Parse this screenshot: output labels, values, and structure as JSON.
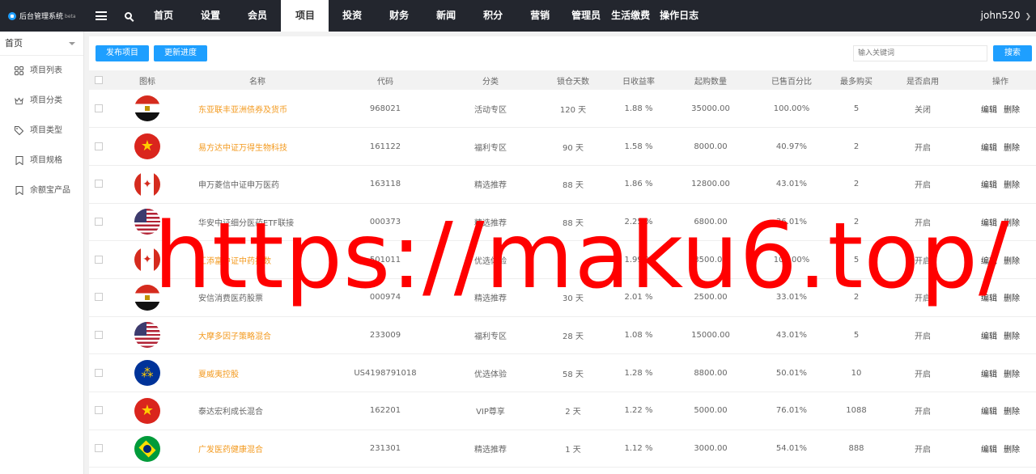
{
  "app": {
    "title": "后台管理系统",
    "badge": "beta"
  },
  "nav": {
    "items": [
      {
        "label": "首页"
      },
      {
        "label": "设置"
      },
      {
        "label": "会员"
      },
      {
        "label": "项目",
        "active": true
      },
      {
        "label": "投资"
      },
      {
        "label": "财务"
      },
      {
        "label": "新闻"
      },
      {
        "label": "积分"
      },
      {
        "label": "营销"
      },
      {
        "label": "管理员"
      },
      {
        "label": "生活缴费"
      },
      {
        "label": "操作日志"
      }
    ],
    "user": "john520"
  },
  "sidebar": {
    "title": "首页",
    "items": [
      {
        "label": "项目列表",
        "icon": "grid-icon"
      },
      {
        "label": "项目分类",
        "icon": "crown-icon"
      },
      {
        "label": "项目类型",
        "icon": "tag-icon"
      },
      {
        "label": "项目规格",
        "icon": "bookmark-icon"
      },
      {
        "label": "余额宝产品",
        "icon": "bookmark-icon"
      }
    ]
  },
  "toolbar": {
    "publish_label": "发布项目",
    "update_label": "更新进度",
    "search_placeholder": "输入关键词",
    "search_label": "搜索"
  },
  "table": {
    "headers": [
      "",
      "图标",
      "名称",
      "代码",
      "分类",
      "锁仓天数",
      "日收益率",
      "起购数量",
      "已售百分比",
      "最多购买",
      "是否启用",
      "操作"
    ],
    "rows": [
      {
        "flag": "egypt",
        "name": "东亚联丰亚洲债券及货币",
        "hl": true,
        "code": "968021",
        "category": "活动专区",
        "days": "120 天",
        "rate": "1.88 %",
        "min": "35000.00",
        "sold": "100.00%",
        "max": "5",
        "enabled": "关闭"
      },
      {
        "flag": "vietnam",
        "name": "易方达中证万得生物科技",
        "hl": true,
        "code": "161122",
        "category": "福利专区",
        "days": "90 天",
        "rate": "1.58 %",
        "min": "8000.00",
        "sold": "40.97%",
        "max": "2",
        "enabled": "开启"
      },
      {
        "flag": "canada",
        "name": "申万菱信中证申万医药",
        "hl": false,
        "code": "163118",
        "category": "精选推荐",
        "days": "88 天",
        "rate": "1.86 %",
        "min": "12800.00",
        "sold": "43.01%",
        "max": "2",
        "enabled": "开启"
      },
      {
        "flag": "usa",
        "name": "华安中证细分医药ETF联接",
        "hl": false,
        "code": "000373",
        "category": "精选推荐",
        "days": "88 天",
        "rate": "2.25 %",
        "min": "6800.00",
        "sold": "36.01%",
        "max": "2",
        "enabled": "开启"
      },
      {
        "flag": "canada",
        "name": "汇添富中证中药指数",
        "hl": true,
        "code": "501011",
        "category": "优选体验",
        "days": "",
        "rate": "1.99 %",
        "min": "3500.00",
        "sold": "100.00%",
        "max": "5",
        "enabled": "开启"
      },
      {
        "flag": "egypt",
        "name": "安信消费医药股票",
        "hl": false,
        "code": "000974",
        "category": "精选推荐",
        "days": "30 天",
        "rate": "2.01 %",
        "min": "2500.00",
        "sold": "33.01%",
        "max": "2",
        "enabled": "开启"
      },
      {
        "flag": "usa",
        "name": "大摩多因子策略混合",
        "hl": true,
        "code": "233009",
        "category": "福利专区",
        "days": "28 天",
        "rate": "1.08 %",
        "min": "15000.00",
        "sold": "43.01%",
        "max": "5",
        "enabled": "开启"
      },
      {
        "flag": "eu",
        "name": "夏威夷控股",
        "hl": true,
        "code": "US4198791018",
        "category": "优选体验",
        "days": "58 天",
        "rate": "1.28 %",
        "min": "8800.00",
        "sold": "50.01%",
        "max": "10",
        "enabled": "开启"
      },
      {
        "flag": "vietnam",
        "name": "泰达宏利成长混合",
        "hl": false,
        "code": "162201",
        "category": "VIP尊享",
        "days": "2 天",
        "rate": "1.22 %",
        "min": "5000.00",
        "sold": "76.01%",
        "max": "1088",
        "enabled": "开启"
      },
      {
        "flag": "brazil",
        "name": "广发医药健康混合",
        "hl": true,
        "code": "231301",
        "category": "精选推荐",
        "days": "1 天",
        "rate": "1.12 %",
        "min": "3000.00",
        "sold": "54.01%",
        "max": "888",
        "enabled": "开启"
      }
    ],
    "edit_label": "编辑",
    "delete_label": "删除"
  },
  "watermark": "https://maku6.top/",
  "colors": {
    "topbar": "#23262e",
    "primary": "#1e9fff",
    "highlight": "#f39a1f",
    "watermark": "#ff0000"
  }
}
